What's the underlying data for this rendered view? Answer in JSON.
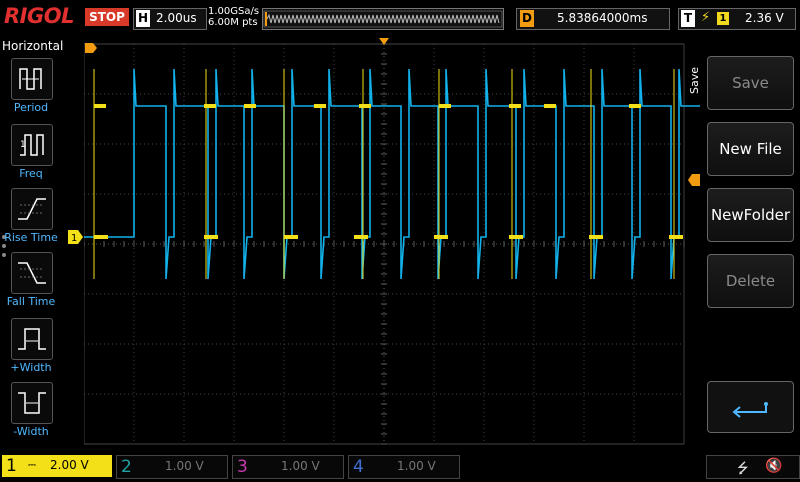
{
  "header": {
    "brand": "RIGOL",
    "run_state": "STOP",
    "horizontal": {
      "label": "H",
      "value": "2.00us"
    },
    "sample_rate": "1.00GSa/s",
    "memory_depth": "6.00M pts",
    "delay": {
      "label": "D",
      "value": "5.83864000ms"
    },
    "trigger": {
      "label": "T",
      "source": "1",
      "level": "2.36 V"
    }
  },
  "left_panel": {
    "title": "Horizontal",
    "items": [
      {
        "label": "Period",
        "icon": "period-icon"
      },
      {
        "label": "Freq",
        "icon": "freq-icon"
      },
      {
        "label": "Rise Time",
        "icon": "rise-time-icon"
      },
      {
        "label": "Fall Time",
        "icon": "fall-time-icon"
      },
      {
        "label": "+Width",
        "icon": "positive-width-icon"
      },
      {
        "label": "-Width",
        "icon": "negative-width-icon"
      }
    ]
  },
  "right_panel": {
    "tab": "Save",
    "buttons": [
      {
        "label": "Save",
        "enabled": false
      },
      {
        "label": "New File",
        "enabled": true
      },
      {
        "label": "NewFolder",
        "enabled": true
      },
      {
        "label": "Delete",
        "enabled": false
      }
    ],
    "back_icon": "return-arrow-icon"
  },
  "channels": [
    {
      "num": "1",
      "scale": "2.00 V",
      "color": "#f4e019",
      "active": true
    },
    {
      "num": "2",
      "scale": "1.00 V",
      "color": "#1fa3a3",
      "active": false
    },
    {
      "num": "3",
      "scale": "1.00 V",
      "color": "#c83cb0",
      "active": false
    },
    {
      "num": "4",
      "scale": "1.00 V",
      "color": "#3f6fd0",
      "active": false
    }
  ],
  "markers": {
    "ch1_ref": "1",
    "trigger_pos_icon": "trigger-position-icon"
  },
  "status_icons": [
    "usb-icon",
    "speaker-muted-icon"
  ],
  "colors": {
    "ch1": "#f4e019",
    "ch2_trace": "#12b1ea",
    "trigger": "#f39c12",
    "grid": "#5a5a5a"
  }
}
